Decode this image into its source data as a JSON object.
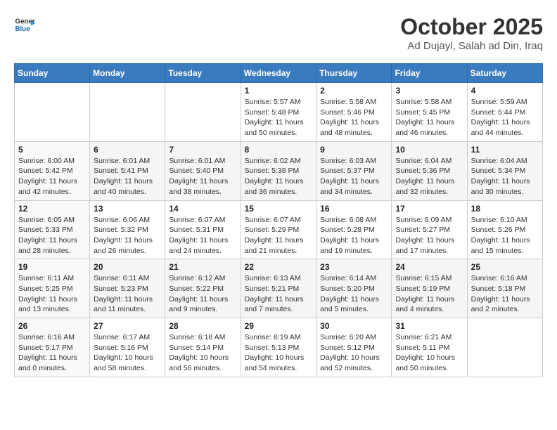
{
  "header": {
    "logo_line1": "General",
    "logo_line2": "Blue",
    "month": "October 2025",
    "location": "Ad Dujayl, Salah ad Din, Iraq"
  },
  "weekdays": [
    "Sunday",
    "Monday",
    "Tuesday",
    "Wednesday",
    "Thursday",
    "Friday",
    "Saturday"
  ],
  "weeks": [
    [
      {
        "day": "",
        "detail": ""
      },
      {
        "day": "",
        "detail": ""
      },
      {
        "day": "",
        "detail": ""
      },
      {
        "day": "1",
        "detail": "Sunrise: 5:57 AM\nSunset: 5:48 PM\nDaylight: 11 hours\nand 50 minutes."
      },
      {
        "day": "2",
        "detail": "Sunrise: 5:58 AM\nSunset: 5:46 PM\nDaylight: 11 hours\nand 48 minutes."
      },
      {
        "day": "3",
        "detail": "Sunrise: 5:58 AM\nSunset: 5:45 PM\nDaylight: 11 hours\nand 46 minutes."
      },
      {
        "day": "4",
        "detail": "Sunrise: 5:59 AM\nSunset: 5:44 PM\nDaylight: 11 hours\nand 44 minutes."
      }
    ],
    [
      {
        "day": "5",
        "detail": "Sunrise: 6:00 AM\nSunset: 5:42 PM\nDaylight: 11 hours\nand 42 minutes."
      },
      {
        "day": "6",
        "detail": "Sunrise: 6:01 AM\nSunset: 5:41 PM\nDaylight: 11 hours\nand 40 minutes."
      },
      {
        "day": "7",
        "detail": "Sunrise: 6:01 AM\nSunset: 5:40 PM\nDaylight: 11 hours\nand 38 minutes."
      },
      {
        "day": "8",
        "detail": "Sunrise: 6:02 AM\nSunset: 5:38 PM\nDaylight: 11 hours\nand 36 minutes."
      },
      {
        "day": "9",
        "detail": "Sunrise: 6:03 AM\nSunset: 5:37 PM\nDaylight: 11 hours\nand 34 minutes."
      },
      {
        "day": "10",
        "detail": "Sunrise: 6:04 AM\nSunset: 5:36 PM\nDaylight: 11 hours\nand 32 minutes."
      },
      {
        "day": "11",
        "detail": "Sunrise: 6:04 AM\nSunset: 5:34 PM\nDaylight: 11 hours\nand 30 minutes."
      }
    ],
    [
      {
        "day": "12",
        "detail": "Sunrise: 6:05 AM\nSunset: 5:33 PM\nDaylight: 11 hours\nand 28 minutes."
      },
      {
        "day": "13",
        "detail": "Sunrise: 6:06 AM\nSunset: 5:32 PM\nDaylight: 11 hours\nand 26 minutes."
      },
      {
        "day": "14",
        "detail": "Sunrise: 6:07 AM\nSunset: 5:31 PM\nDaylight: 11 hours\nand 24 minutes."
      },
      {
        "day": "15",
        "detail": "Sunrise: 6:07 AM\nSunset: 5:29 PM\nDaylight: 11 hours\nand 21 minutes."
      },
      {
        "day": "16",
        "detail": "Sunrise: 6:08 AM\nSunset: 5:28 PM\nDaylight: 11 hours\nand 19 minutes."
      },
      {
        "day": "17",
        "detail": "Sunrise: 6:09 AM\nSunset: 5:27 PM\nDaylight: 11 hours\nand 17 minutes."
      },
      {
        "day": "18",
        "detail": "Sunrise: 6:10 AM\nSunset: 5:26 PM\nDaylight: 11 hours\nand 15 minutes."
      }
    ],
    [
      {
        "day": "19",
        "detail": "Sunrise: 6:11 AM\nSunset: 5:25 PM\nDaylight: 11 hours\nand 13 minutes."
      },
      {
        "day": "20",
        "detail": "Sunrise: 6:11 AM\nSunset: 5:23 PM\nDaylight: 11 hours\nand 11 minutes."
      },
      {
        "day": "21",
        "detail": "Sunrise: 6:12 AM\nSunset: 5:22 PM\nDaylight: 11 hours\nand 9 minutes."
      },
      {
        "day": "22",
        "detail": "Sunrise: 6:13 AM\nSunset: 5:21 PM\nDaylight: 11 hours\nand 7 minutes."
      },
      {
        "day": "23",
        "detail": "Sunrise: 6:14 AM\nSunset: 5:20 PM\nDaylight: 11 hours\nand 5 minutes."
      },
      {
        "day": "24",
        "detail": "Sunrise: 6:15 AM\nSunset: 5:19 PM\nDaylight: 11 hours\nand 4 minutes."
      },
      {
        "day": "25",
        "detail": "Sunrise: 6:16 AM\nSunset: 5:18 PM\nDaylight: 11 hours\nand 2 minutes."
      }
    ],
    [
      {
        "day": "26",
        "detail": "Sunrise: 6:16 AM\nSunset: 5:17 PM\nDaylight: 11 hours\nand 0 minutes."
      },
      {
        "day": "27",
        "detail": "Sunrise: 6:17 AM\nSunset: 5:16 PM\nDaylight: 10 hours\nand 58 minutes."
      },
      {
        "day": "28",
        "detail": "Sunrise: 6:18 AM\nSunset: 5:14 PM\nDaylight: 10 hours\nand 56 minutes."
      },
      {
        "day": "29",
        "detail": "Sunrise: 6:19 AM\nSunset: 5:13 PM\nDaylight: 10 hours\nand 54 minutes."
      },
      {
        "day": "30",
        "detail": "Sunrise: 6:20 AM\nSunset: 5:12 PM\nDaylight: 10 hours\nand 52 minutes."
      },
      {
        "day": "31",
        "detail": "Sunrise: 6:21 AM\nSunset: 5:11 PM\nDaylight: 10 hours\nand 50 minutes."
      },
      {
        "day": "",
        "detail": ""
      }
    ]
  ]
}
